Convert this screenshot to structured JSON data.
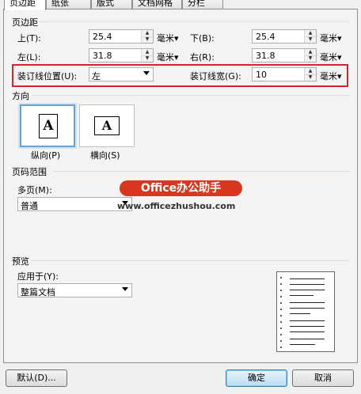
{
  "tabs": [
    "页边距",
    "纸张",
    "版式",
    "文档网格",
    "分栏"
  ],
  "margins": {
    "section_title": "页边距",
    "top_label": "上(T):",
    "top_value": "25.4",
    "bottom_label": "下(B):",
    "bottom_value": "25.4",
    "left_label": "左(L):",
    "left_value": "31.8",
    "right_label": "右(R):",
    "right_value": "31.8",
    "unit": "毫米",
    "gutter_pos_label": "装订线位置(U):",
    "gutter_pos_value": "左",
    "gutter_width_label": "装订线宽(G):",
    "gutter_width_value": "10"
  },
  "orientation": {
    "section_title": "方向",
    "portrait_label": "纵向(P)",
    "landscape_label": "横向(S)",
    "icon_letter": "A",
    "selected": "portrait"
  },
  "pages": {
    "section_title": "页码范围",
    "multi_label": "多页(M):",
    "multi_value": "普通"
  },
  "preview": {
    "section_title": "预览",
    "apply_label": "应用于(Y):",
    "apply_value": "整篇文档"
  },
  "buttons": {
    "default": "默认(D)...",
    "ok": "确定",
    "cancel": "取消"
  },
  "watermark": {
    "brand": "Office办公助手",
    "url": "www.officezhushou.com"
  },
  "colors": {
    "highlight": "#d8222a",
    "watermark": "#d9361e"
  },
  "icons": {
    "spin": "spin-arrows",
    "dropdown": "caret-down"
  }
}
